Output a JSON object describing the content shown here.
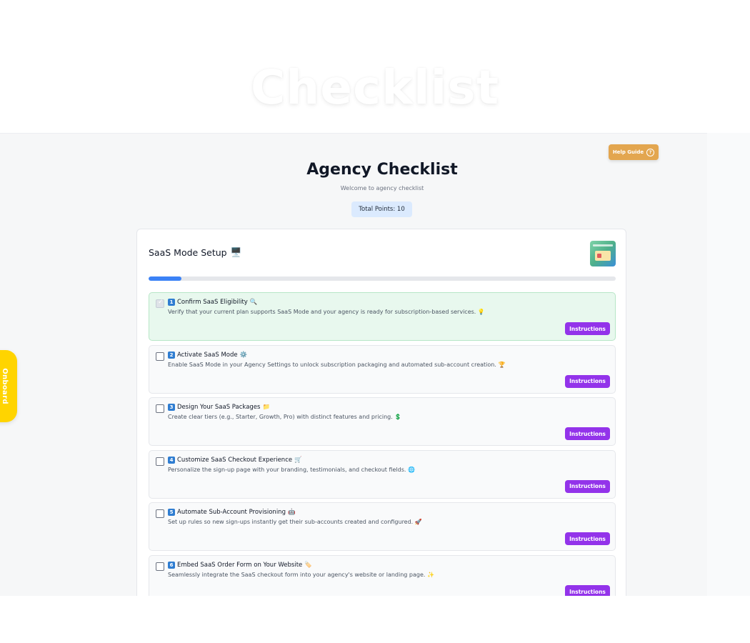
{
  "hero": {
    "title": "Checklist"
  },
  "header": {
    "help_label": "Help Guide",
    "help_icon": "?",
    "title": "Agency Checklist",
    "subtitle": "Welcome to agency checklist",
    "points": "Total Points: 10"
  },
  "section": {
    "title": "SaaS Mode Setup",
    "title_icon": "🖥️",
    "progress_fraction": 0.07
  },
  "items": [
    {
      "num": "1",
      "title": "Confirm SaaS Eligibility",
      "title_emoji": "🔍",
      "desc": "Verify that your current plan supports SaaS Mode and your agency is ready for subscription-based services.",
      "desc_emoji": "💡",
      "checked": true,
      "button": "Instructions"
    },
    {
      "num": "2",
      "title": "Activate SaaS Mode",
      "title_emoji": "⚙️",
      "desc": "Enable SaaS Mode in your Agency Settings to unlock subscription packaging and automated sub-account creation.",
      "desc_emoji": "🏆",
      "checked": false,
      "button": "Instructions"
    },
    {
      "num": "3",
      "title": "Design Your SaaS Packages",
      "title_emoji": "📁",
      "desc": "Create clear tiers (e.g., Starter, Growth, Pro) with distinct features and pricing.",
      "desc_emoji": "💲",
      "checked": false,
      "button": "Instructions"
    },
    {
      "num": "4",
      "title": "Customize SaaS Checkout Experience",
      "title_emoji": "🛒",
      "desc": "Personalize the sign-up page with your branding, testimonials, and checkout fields.",
      "desc_emoji": "🌐",
      "checked": false,
      "button": "Instructions"
    },
    {
      "num": "5",
      "title": "Automate Sub-Account Provisioning",
      "title_emoji": "🤖",
      "desc": "Set up rules so new sign-ups instantly get their sub-accounts created and configured.",
      "desc_emoji": "🚀",
      "checked": false,
      "button": "Instructions"
    },
    {
      "num": "6",
      "title": "Embed SaaS Order Form on Your Website",
      "title_emoji": "🏷️",
      "desc": "Seamlessly integrate the SaaS checkout form into your agency's website or landing page.",
      "desc_emoji": "✨",
      "checked": false,
      "button": "Instructions"
    }
  ],
  "onboard": {
    "label": "Onboard"
  }
}
